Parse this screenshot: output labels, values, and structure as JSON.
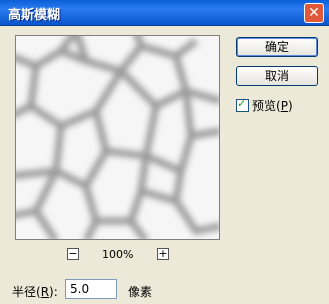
{
  "window": {
    "title": "高斯模糊",
    "close_symbol": "✕"
  },
  "buttons": {
    "ok": "确定",
    "cancel": "取消"
  },
  "preview_option": {
    "label_prefix": "预览(",
    "accelerator": "P",
    "label_suffix": ")",
    "checked": true
  },
  "zoom": {
    "minus": "−",
    "plus": "+",
    "level": "100%"
  },
  "radius": {
    "label_prefix": "半径(",
    "accelerator": "R",
    "label_suffix": "):",
    "value": "5.0",
    "unit": "像素"
  },
  "colors": {
    "titlebar": "#0a5fd8",
    "dialog_bg": "#ece9d8",
    "button_border": "#003c74"
  }
}
